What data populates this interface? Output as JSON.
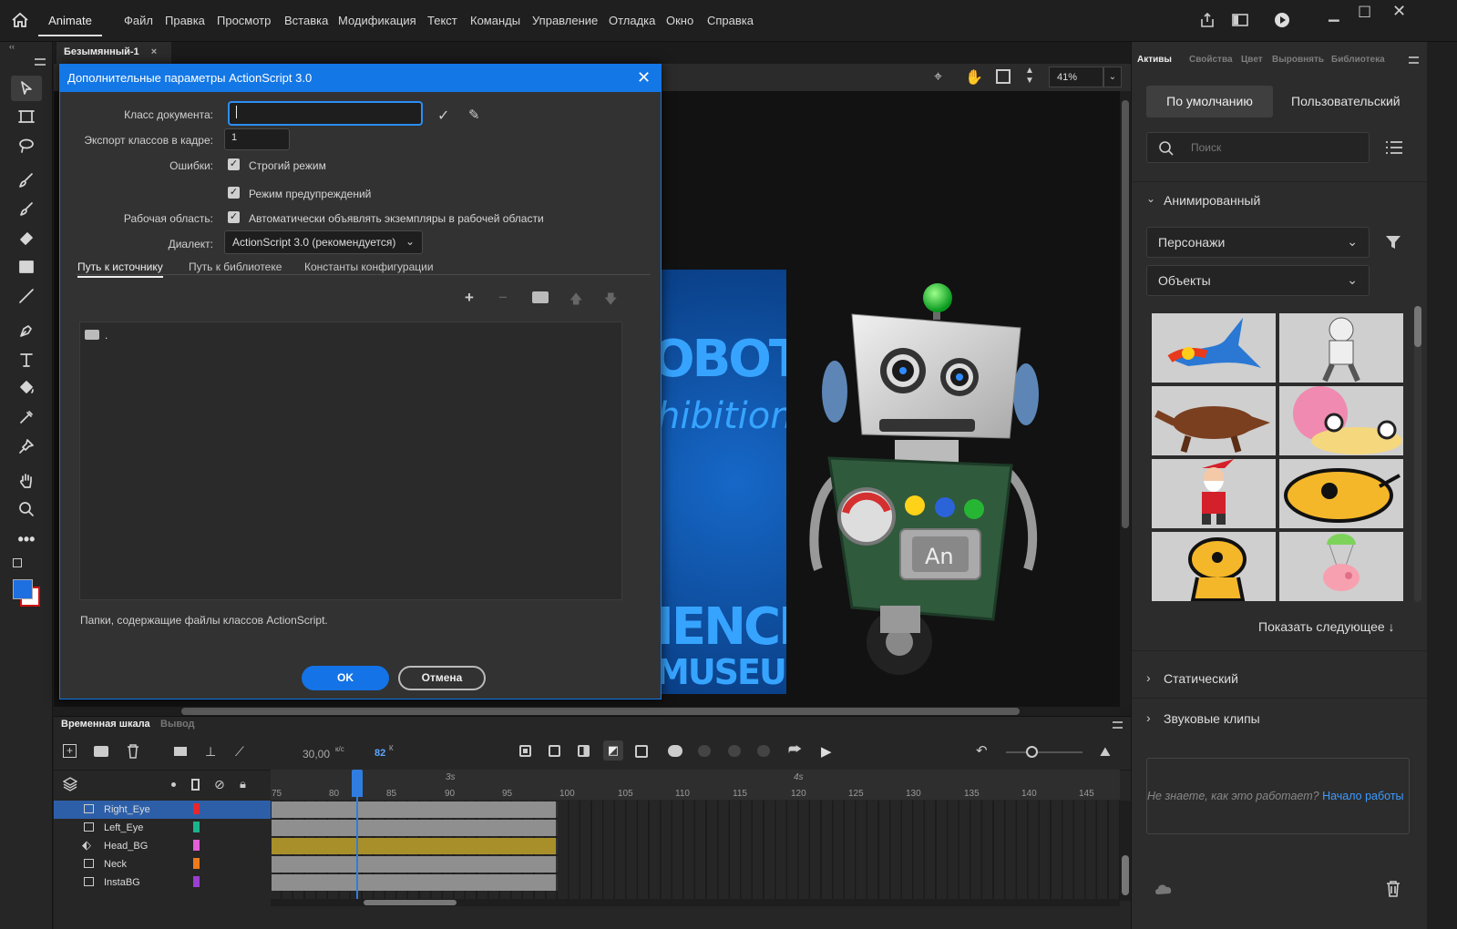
{
  "app": {
    "name": "Animate",
    "menu": [
      "Файл",
      "Правка",
      "Просмотр",
      "Вставка",
      "Модификация",
      "Текст",
      "Команды",
      "Управление",
      "Отладка",
      "Окно",
      "Справка"
    ]
  },
  "document": {
    "tab_title": "Безымянный-1",
    "zoom": "41%"
  },
  "dialog": {
    "title": "Дополнительные параметры ActionScript 3.0",
    "doc_class_label": "Класс документа:",
    "doc_class_value": "",
    "export_label": "Экспорт классов в кадре:",
    "export_value": "1",
    "errors_label": "Ошибки:",
    "strict_mode": "Строгий режим",
    "warnings_mode": "Режим предупреждений",
    "workspace_label": "Рабочая область:",
    "auto_declare": "Автоматически объявлять экземпляры в рабочей области",
    "dialect_label": "Диалект:",
    "dialect_value": "ActionScript 3.0 (рекомендуется)",
    "tabs": [
      "Путь к источнику",
      "Путь к библиотеке",
      "Константы конфигурации"
    ],
    "path_entry": ".",
    "hint": "Папки, содержащие файлы классов ActionScript.",
    "ok": "OK",
    "cancel": "Отмена"
  },
  "assets_panel": {
    "tabs": [
      "Активы",
      "Свойства",
      "Цвет",
      "Выровнять",
      "Библиотека"
    ],
    "mode_default": "По умолчанию",
    "mode_custom": "Пользовательский",
    "search_placeholder": "Поиск",
    "section_animated": "Анимированный",
    "dropdown_characters": "Персонажи",
    "dropdown_objects": "Объекты",
    "show_more": "Показать следующее ↓",
    "section_static": "Статический",
    "section_sound": "Звуковые клипы",
    "help_text": "Не знаете, как это работает?",
    "help_link": "Начало работы"
  },
  "poster": {
    "line1": "OBOTS",
    "line2": "hibition",
    "line3": "IENCE",
    "line4": "MUSEUM"
  },
  "robot_badge": "An",
  "timeline": {
    "tabs": [
      "Временная шкала",
      "Вывод"
    ],
    "fps": "30,00",
    "fps_unit": "к/с",
    "frame": "82",
    "frame_unit": "К",
    "ruler_sec": [
      "3s",
      "4s"
    ],
    "ruler": [
      "75",
      "80",
      "85",
      "90",
      "95",
      "100",
      "105",
      "110",
      "115",
      "120",
      "125",
      "130",
      "135",
      "140",
      "145"
    ],
    "layers": [
      {
        "name": "Right_Eye",
        "color": "#e8262d"
      },
      {
        "name": "Left_Eye",
        "color": "#1bb38c"
      },
      {
        "name": "Head_BG",
        "color": "#e35fd8"
      },
      {
        "name": "Neck",
        "color": "#ee7a1c"
      },
      {
        "name": "InstaBG",
        "color": "#9a3fd1"
      }
    ]
  }
}
